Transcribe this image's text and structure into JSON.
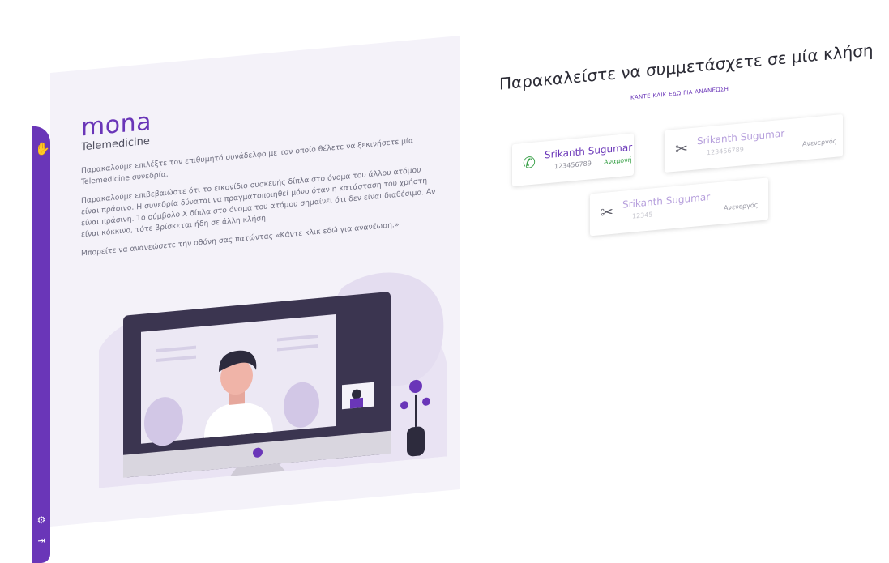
{
  "sidebar": {
    "logo_icon": "hand-wave-icon",
    "settings_icon": "gear-icon",
    "logout_icon": "logout-icon"
  },
  "brand": {
    "name": "mona",
    "subtitle": "Telemedicine"
  },
  "intro": {
    "p1": "Παρακαλούμε επιλέξτε τον επιθυμητό συνάδελφο με τον οποίο θέλετε να ξεκινήσετε μία Telemedicine συνεδρία.",
    "p2": "Παρακαλούμε επιβεβαιώστε ότι το εικονίδιο συσκευής δίπλα στο όνομα του άλλου ατόμου είναι πράσινο. Η συνεδρία δύναται να πραγματοποιηθεί μόνο όταν η κατάσταση του χρήστη είναι πράσινη. Το σύμβολο X δίπλα στο όνομα του ατόμου σημαίνει ότι δεν είναι διαθέσιμο. Αν είναι κόκκινο, τότε βρίσκεται ήδη σε άλλη κλήση.",
    "p3": "Μπορείτε να ανανεώσετε την οθόνη σας πατώντας «Κάντε κλικ εδώ για ανανέωση.»"
  },
  "main": {
    "headline": "Παρακαλείστε να συμμετάσχετε σε μία κλήση",
    "refresh_label": "ΚΑΝΤΕ ΚΛΙΚ ΕΔΩ ΓΙΑ ΑΝΑΝΕΩΣΗ",
    "contacts": [
      {
        "name": "Srikanth Sugumar",
        "id": "123456789",
        "status": "Αναμονή",
        "icon": "phone-icon",
        "state": "active"
      },
      {
        "name": "Srikanth Sugumar",
        "id": "123456789",
        "status": "Ανενεργός",
        "icon": "phone-off-icon",
        "state": "inactive"
      },
      {
        "name": "Srikanth Sugumar",
        "id": "12345",
        "status": "Ανενεργός",
        "icon": "phone-off-icon",
        "state": "inactive"
      }
    ]
  },
  "colors": {
    "accent": "#6a36b8",
    "online": "#3aa149",
    "panel_bg": "#f4f2f9"
  }
}
